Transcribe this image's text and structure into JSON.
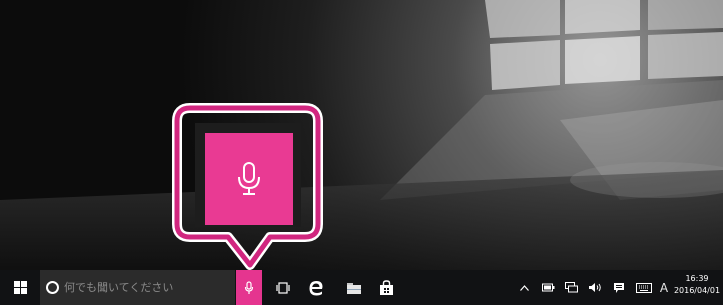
{
  "taskbar": {
    "search": {
      "placeholder": "何でも聞いてください"
    },
    "clock": {
      "time": "16:39",
      "date": "2016/04/01"
    },
    "ime_label": "A"
  },
  "icons": {
    "start": "windows-logo-icon",
    "search": "search-circle-icon",
    "microphone": "microphone-icon",
    "task_view": "task-view-icon",
    "edge": "edge-browser-icon",
    "explorer": "file-explorer-icon",
    "store": "store-icon",
    "tray_chevron": "chevron-up-icon",
    "battery": "battery-icon",
    "network": "network-icon",
    "volume": "volume-icon",
    "action_center": "action-center-icon",
    "keyboard": "touch-keyboard-icon"
  },
  "colors": {
    "accent": "#e5358f",
    "callout_border": "#d1267f",
    "taskbar": "#111214"
  }
}
